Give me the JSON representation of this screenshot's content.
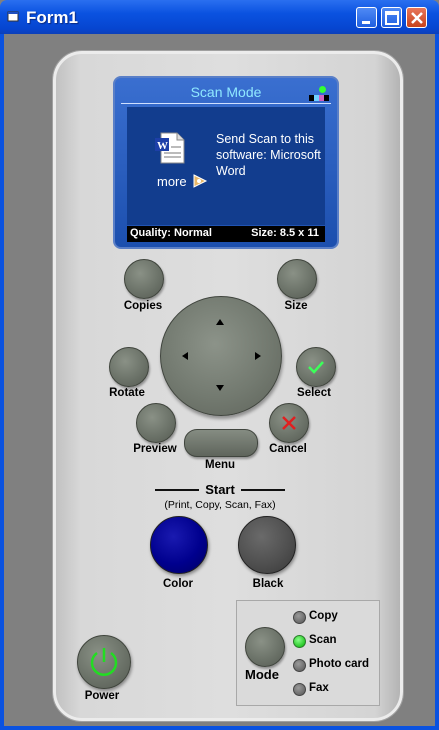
{
  "window": {
    "title": "Form1"
  },
  "lcd": {
    "title": "Scan Mode",
    "message": "Send Scan to this software: Microsoft Word",
    "more_label": "more",
    "quality": "Quality: Normal",
    "size": "Size: 8.5 x 11"
  },
  "buttons": {
    "copies": "Copies",
    "size": "Size",
    "rotate": "Rotate",
    "select": "Select",
    "preview": "Preview",
    "cancel": "Cancel",
    "menu": "Menu",
    "color": "Color",
    "black": "Black",
    "power": "Power",
    "mode": "Mode"
  },
  "start": {
    "title": "Start",
    "subtitle": "(Print, Copy, Scan, Fax)"
  },
  "modes": [
    {
      "label": "Copy",
      "active": false
    },
    {
      "label": "Scan",
      "active": true
    },
    {
      "label": "Photo card",
      "active": false
    },
    {
      "label": "Fax",
      "active": false
    }
  ],
  "colors": {
    "color_button": "#00008e",
    "black_button": "#505050",
    "led_on": "#00c000",
    "power_icon": "#22dd22"
  }
}
